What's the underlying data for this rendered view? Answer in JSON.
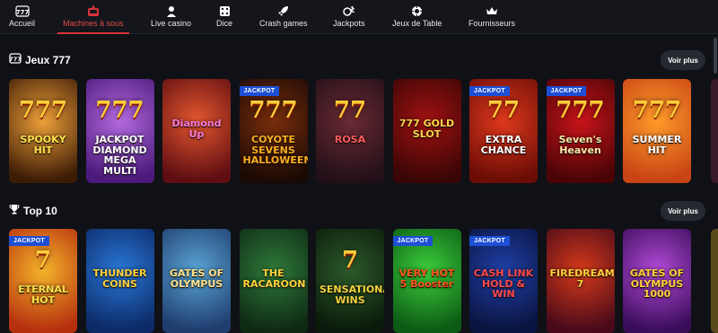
{
  "nav": [
    {
      "id": "accueil",
      "label": "Accueil",
      "icon": "slot-777-icon",
      "active": false
    },
    {
      "id": "machines",
      "label": "Machines à sous",
      "icon": "slot-machine-icon",
      "active": true
    },
    {
      "id": "live",
      "label": "Live casino",
      "icon": "live-dealer-icon",
      "active": false
    },
    {
      "id": "dice",
      "label": "Dice",
      "icon": "dice-icon",
      "active": false
    },
    {
      "id": "crash",
      "label": "Crash games",
      "icon": "rocket-icon",
      "active": false
    },
    {
      "id": "jackpots",
      "label": "Jackpots",
      "icon": "jackpot-coins-icon",
      "active": false
    },
    {
      "id": "table",
      "label": "Jeux de Table",
      "icon": "chip-icon",
      "active": false
    },
    {
      "id": "fournisseurs",
      "label": "Fournisseurs",
      "icon": "crown-icon",
      "active": false
    }
  ],
  "sections": [
    {
      "title": "Jeux 777",
      "icon": "slot-777-icon",
      "voir_plus": "Voir plus",
      "games": [
        {
          "name": "SPOOKY HIT",
          "sevens": "777",
          "jackpot": false,
          "bg": [
            "#f0a13a",
            "#3d1c06"
          ],
          "color": "#ffe14a"
        },
        {
          "name": "JACKPOT DIAMOND MEGA MULTI",
          "sevens": "777",
          "jackpot": false,
          "bg": [
            "#b46ae0",
            "#4b1a7a"
          ],
          "color": "#ffffff"
        },
        {
          "name": "Diamond Up",
          "sevens": "",
          "jackpot": false,
          "bg": [
            "#e4572e",
            "#5e0d12"
          ],
          "color": "#ff7ad9"
        },
        {
          "name": "COYOTE SEVENS HALLOWEEN",
          "sevens": "777",
          "jackpot": true,
          "bg": [
            "#7a2e0c",
            "#1b0a04"
          ],
          "color": "#ffb020"
        },
        {
          "name": "ROSA",
          "sevens": "77",
          "jackpot": false,
          "bg": [
            "#6a2a34",
            "#231018"
          ],
          "color": "#ff5a5a"
        },
        {
          "name": "777 GOLD SLOT",
          "sevens": "",
          "jackpot": false,
          "bg": [
            "#a11212",
            "#3a0505"
          ],
          "color": "#ffd54a"
        },
        {
          "name": "EXTRA CHANCE",
          "sevens": "77",
          "jackpot": true,
          "bg": [
            "#e0391d",
            "#6b0d05"
          ],
          "color": "#ffffff"
        },
        {
          "name": "Seven's Heaven",
          "sevens": "777",
          "jackpot": true,
          "bg": [
            "#c8141a",
            "#4a0406"
          ],
          "color": "#ffe9a8"
        },
        {
          "name": "SUMMER HIT",
          "sevens": "777",
          "jackpot": false,
          "bg": [
            "#ff9c2a",
            "#c84414"
          ],
          "color": "#ffffff"
        }
      ]
    },
    {
      "title": "Top 10",
      "icon": "trophy-icon",
      "voir_plus": "Voir plus",
      "games": [
        {
          "name": "ETERNAL HOT",
          "sevens": "7",
          "jackpot": true,
          "bg": [
            "#f4b42a",
            "#b6300e"
          ],
          "color": "#ffe14a"
        },
        {
          "name": "THUNDER COINS",
          "sevens": "",
          "jackpot": false,
          "bg": [
            "#2a78d8",
            "#0c2a66"
          ],
          "color": "#ffd13a"
        },
        {
          "name": "GATES OF OLYMPUS",
          "sevens": "",
          "jackpot": false,
          "bg": [
            "#5aa6d6",
            "#1f3d6e"
          ],
          "color": "#ffe38a"
        },
        {
          "name": "THE RACAROON",
          "sevens": "",
          "jackpot": false,
          "bg": [
            "#2f7a3a",
            "#0e2a14"
          ],
          "color": "#ffd13a"
        },
        {
          "name": "SENSATIONAL WINS",
          "sevens": "7",
          "jackpot": false,
          "bg": [
            "#2c5a2a",
            "#0b1b0b"
          ],
          "color": "#f5d23a"
        },
        {
          "name": "VERY HOT 5 Booster",
          "sevens": "",
          "jackpot": true,
          "bg": [
            "#3ccf3c",
            "#0c5a14"
          ],
          "color": "#ff5a1a"
        },
        {
          "name": "CASH LINK HOLD & WIN",
          "sevens": "",
          "jackpot": true,
          "bg": [
            "#2040a8",
            "#0a1440"
          ],
          "color": "#ff4a4a"
        },
        {
          "name": "FIREDREAM 7",
          "sevens": "",
          "jackpot": false,
          "bg": [
            "#d63a1a",
            "#4a0a1a"
          ],
          "color": "#ffd13a"
        },
        {
          "name": "GATES OF OLYMPUS 1000",
          "sevens": "",
          "jackpot": false,
          "bg": [
            "#b44ad8",
            "#3a0d5a"
          ],
          "color": "#ffd13a"
        }
      ]
    }
  ],
  "jackpot_label": "JACKPOT"
}
